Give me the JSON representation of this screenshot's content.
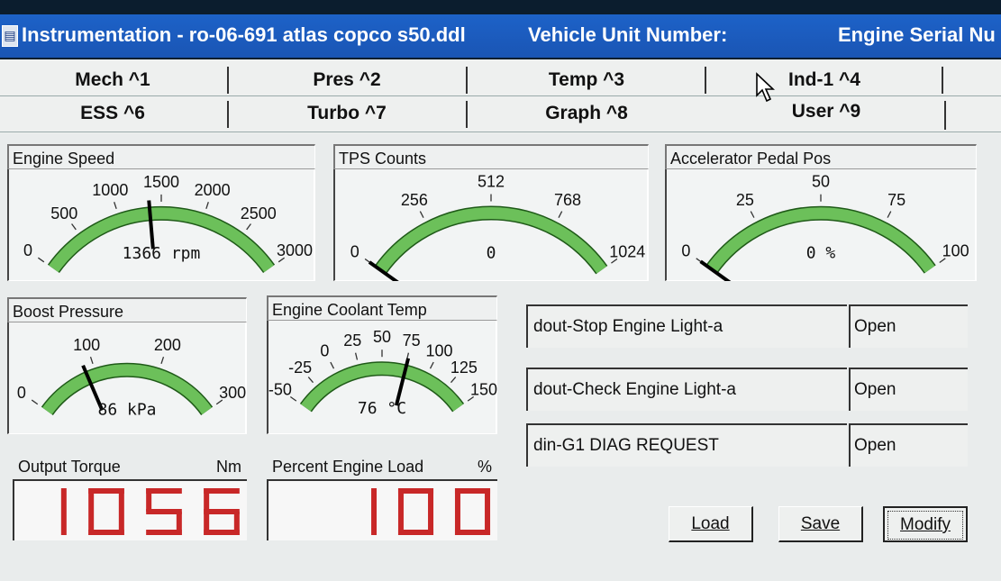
{
  "window": {
    "title": "Instrumentation - ro-06-691 atlas copco s50.ddl",
    "vehicle_label": "Vehicle Unit Number:",
    "engine_label": "Engine Serial Nu"
  },
  "tabs": {
    "row1": [
      "Mech ^1",
      "Pres ^2",
      "Temp ^3",
      "Ind-1 ^4"
    ],
    "row2": [
      "ESS ^6",
      "Turbo ^7",
      "Graph ^8",
      "User ^9"
    ]
  },
  "gauges": [
    {
      "id": "engine-speed",
      "title": "Engine Speed",
      "min": 0,
      "max": 3000,
      "value": 1366,
      "unit": "rpm",
      "readout": "1366  rpm",
      "ticks": [
        {
          "v": 0,
          "label": "0"
        },
        {
          "v": 500,
          "label": "500"
        },
        {
          "v": 1000,
          "label": "1000"
        },
        {
          "v": 1500,
          "label": "1500"
        },
        {
          "v": 2000,
          "label": "2000"
        },
        {
          "v": 2500,
          "label": "2500"
        },
        {
          "v": 3000,
          "label": "3000"
        }
      ]
    },
    {
      "id": "tps-counts",
      "title": "TPS Counts",
      "min": 0,
      "max": 1024,
      "value": 0,
      "unit": "",
      "readout": "0",
      "ticks": [
        {
          "v": 0,
          "label": "0"
        },
        {
          "v": 256,
          "label": "256"
        },
        {
          "v": 512,
          "label": "512"
        },
        {
          "v": 768,
          "label": "768"
        },
        {
          "v": 1024,
          "label": "1024"
        }
      ]
    },
    {
      "id": "accelerator-pedal",
      "title": "Accelerator Pedal Pos",
      "min": 0,
      "max": 100,
      "value": 0,
      "unit": "%",
      "readout": "0  %",
      "ticks": [
        {
          "v": 0,
          "label": "0"
        },
        {
          "v": 25,
          "label": "25"
        },
        {
          "v": 50,
          "label": "50"
        },
        {
          "v": 75,
          "label": "75"
        },
        {
          "v": 100,
          "label": "100"
        }
      ]
    },
    {
      "id": "boost-pressure",
      "title": "Boost Pressure",
      "min": 0,
      "max": 300,
      "value": 86,
      "unit": "kPa",
      "readout": "86  kPa",
      "ticks": [
        {
          "v": 0,
          "label": "0"
        },
        {
          "v": 100,
          "label": "100"
        },
        {
          "v": 200,
          "label": "200"
        },
        {
          "v": 300,
          "label": "300"
        }
      ]
    },
    {
      "id": "coolant-temp",
      "title": "Engine Coolant Temp",
      "min": -50,
      "max": 150,
      "value": 76,
      "unit": "°C",
      "readout": "76  °C",
      "ticks": [
        {
          "v": -50,
          "label": "-50"
        },
        {
          "v": -25,
          "label": "-25"
        },
        {
          "v": 0,
          "label": "0"
        },
        {
          "v": 25,
          "label": "25"
        },
        {
          "v": 50,
          "label": "50"
        },
        {
          "v": 75,
          "label": "75"
        },
        {
          "v": 100,
          "label": "100"
        },
        {
          "v": 125,
          "label": "125"
        },
        {
          "v": 150,
          "label": "150"
        }
      ]
    }
  ],
  "digital": [
    {
      "id": "output-torque",
      "title": "Output Torque",
      "unit": "Nm",
      "value": "1056"
    },
    {
      "id": "percent-load",
      "title": "Percent Engine Load",
      "unit": "%",
      "value": "100"
    }
  ],
  "outputs": [
    {
      "label": "dout-Stop Engine Light-a",
      "value": "Open"
    },
    {
      "label": "dout-Check Engine Light-a",
      "value": "Open"
    },
    {
      "label": "din-G1 DIAG REQUEST",
      "value": "Open"
    }
  ],
  "buttons": {
    "load": "Load",
    "save": "Save",
    "modify": "Modify"
  },
  "colors": {
    "titlebar": "#1d62c8",
    "arc": "#6cc05a",
    "digits": "#c82828"
  }
}
